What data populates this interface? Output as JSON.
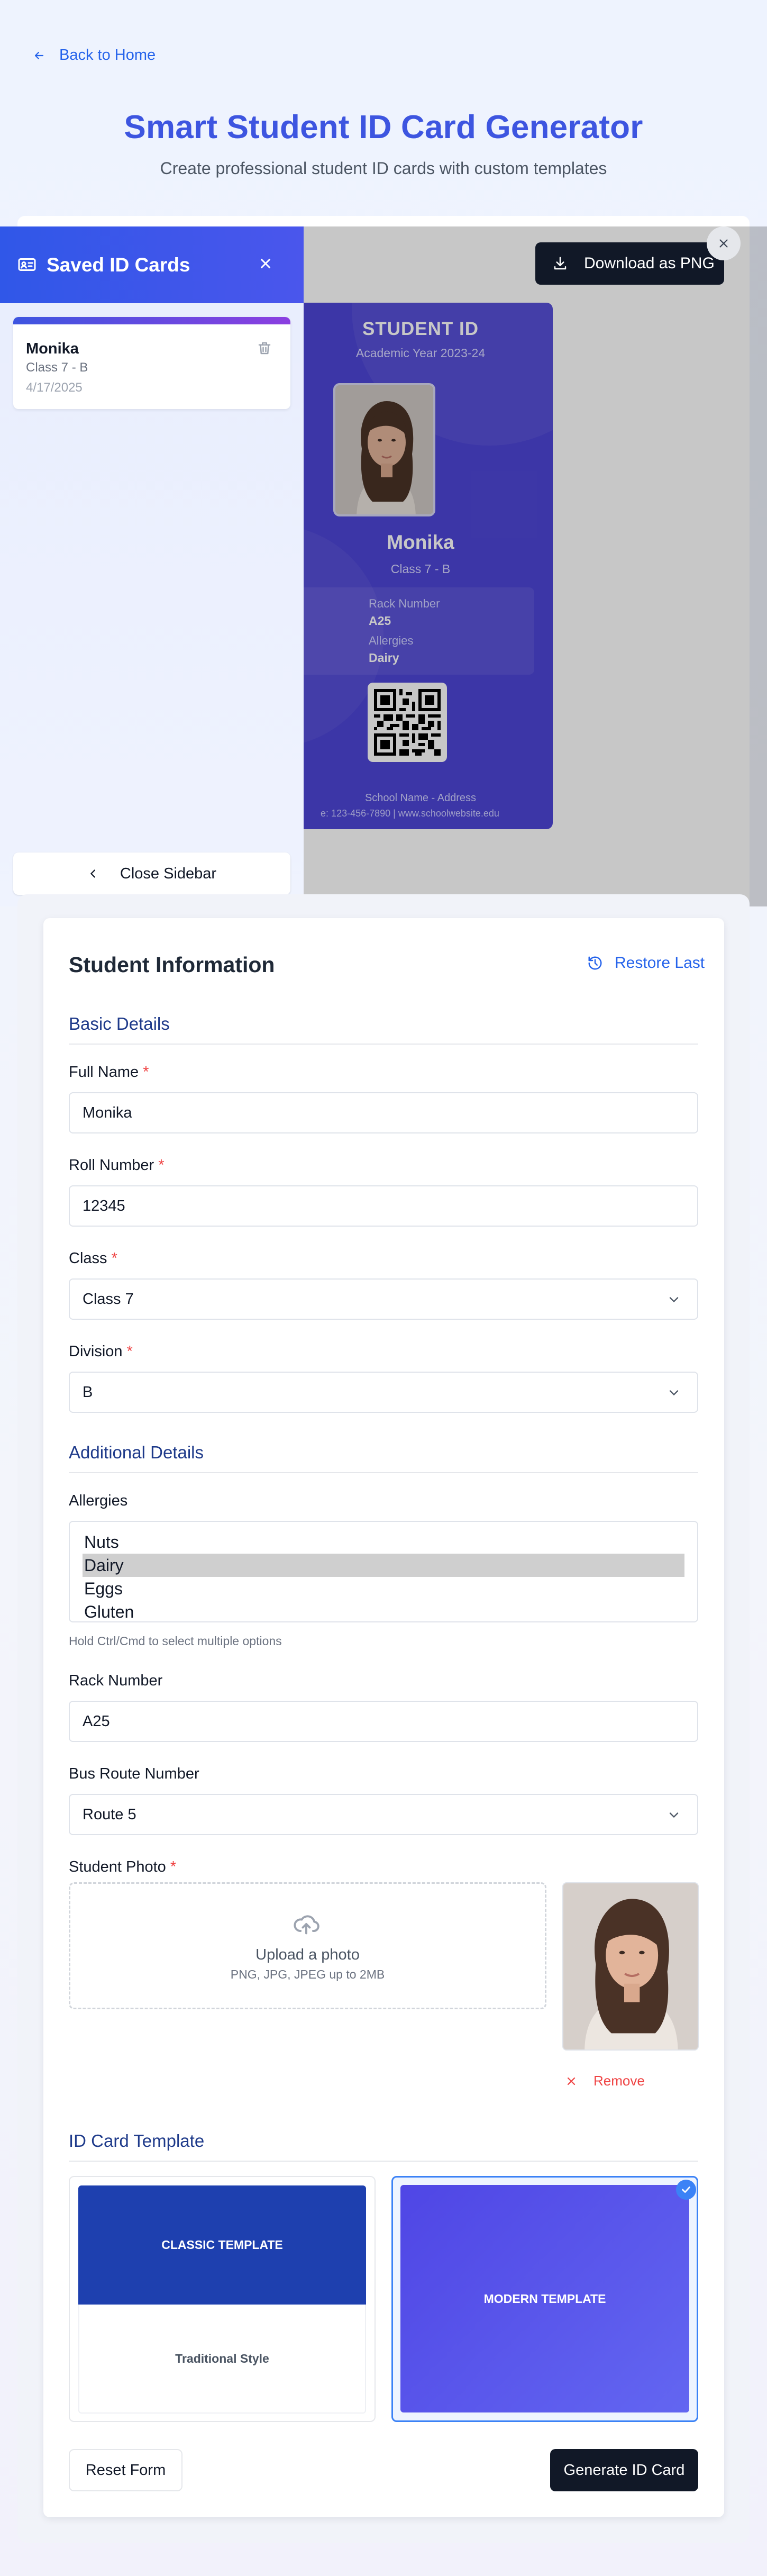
{
  "nav": {
    "back_label": "Back to Home"
  },
  "header": {
    "title": "Smart Student ID Card Generator",
    "subtitle": "Create professional student ID cards with custom templates"
  },
  "preview": {
    "download_label": "Download as PNG",
    "card": {
      "heading": "STUDENT ID",
      "academic_year": "Academic Year 2023-24",
      "name": "Monika",
      "class_division": "Class 7 - B",
      "left_label_partial": "er",
      "rack_label": "Rack Number",
      "rack_value": "A25",
      "allergies_label": "Allergies",
      "allergies_value": "Dairy",
      "school_line": "School Name - Address",
      "contact_line": "e: 123-456-7890 | www.schoolwebsite.edu"
    }
  },
  "sidebar": {
    "title": "Saved ID Cards",
    "saved_cards": [
      {
        "name": "Monika",
        "class_division": "Class 7 - B",
        "date": "4/17/2025"
      }
    ],
    "close_label": "Close Sidebar"
  },
  "form": {
    "title": "Student Information",
    "restore_label": "Restore Last",
    "basic_section": "Basic Details",
    "full_name": {
      "label": "Full Name",
      "value": "Monika"
    },
    "roll_number": {
      "label": "Roll Number",
      "value": "12345"
    },
    "class": {
      "label": "Class",
      "value": "Class 7"
    },
    "division": {
      "label": "Division",
      "value": "B"
    },
    "required_mark": "*",
    "additional_section": "Additional Details",
    "allergies": {
      "label": "Allergies",
      "options": [
        "Nuts",
        "Dairy",
        "Eggs",
        "Gluten"
      ],
      "selected": "Dairy",
      "hint": "Hold Ctrl/Cmd to select multiple options"
    },
    "rack_number": {
      "label": "Rack Number",
      "value": "A25"
    },
    "bus_route": {
      "label": "Bus Route Number",
      "value": "Route 5"
    },
    "photo": {
      "label": "Student Photo",
      "upload_title": "Upload a photo",
      "upload_hint": "PNG, JPG, JPEG up to 2MB",
      "remove_label": "Remove"
    },
    "template_section": "ID Card Template",
    "templates": {
      "classic_name": "CLASSIC TEMPLATE",
      "classic_caption": "Traditional Style",
      "modern_name": "MODERN TEMPLATE",
      "selected": "modern"
    },
    "reset_label": "Reset Form",
    "generate_label": "Generate ID Card"
  },
  "colors": {
    "accent": "#3d55e0",
    "link": "#2563eb",
    "card_bg": "#4e46d6",
    "classic_bg": "#1e40af",
    "dark_button": "#111827",
    "required": "#ef4444"
  }
}
